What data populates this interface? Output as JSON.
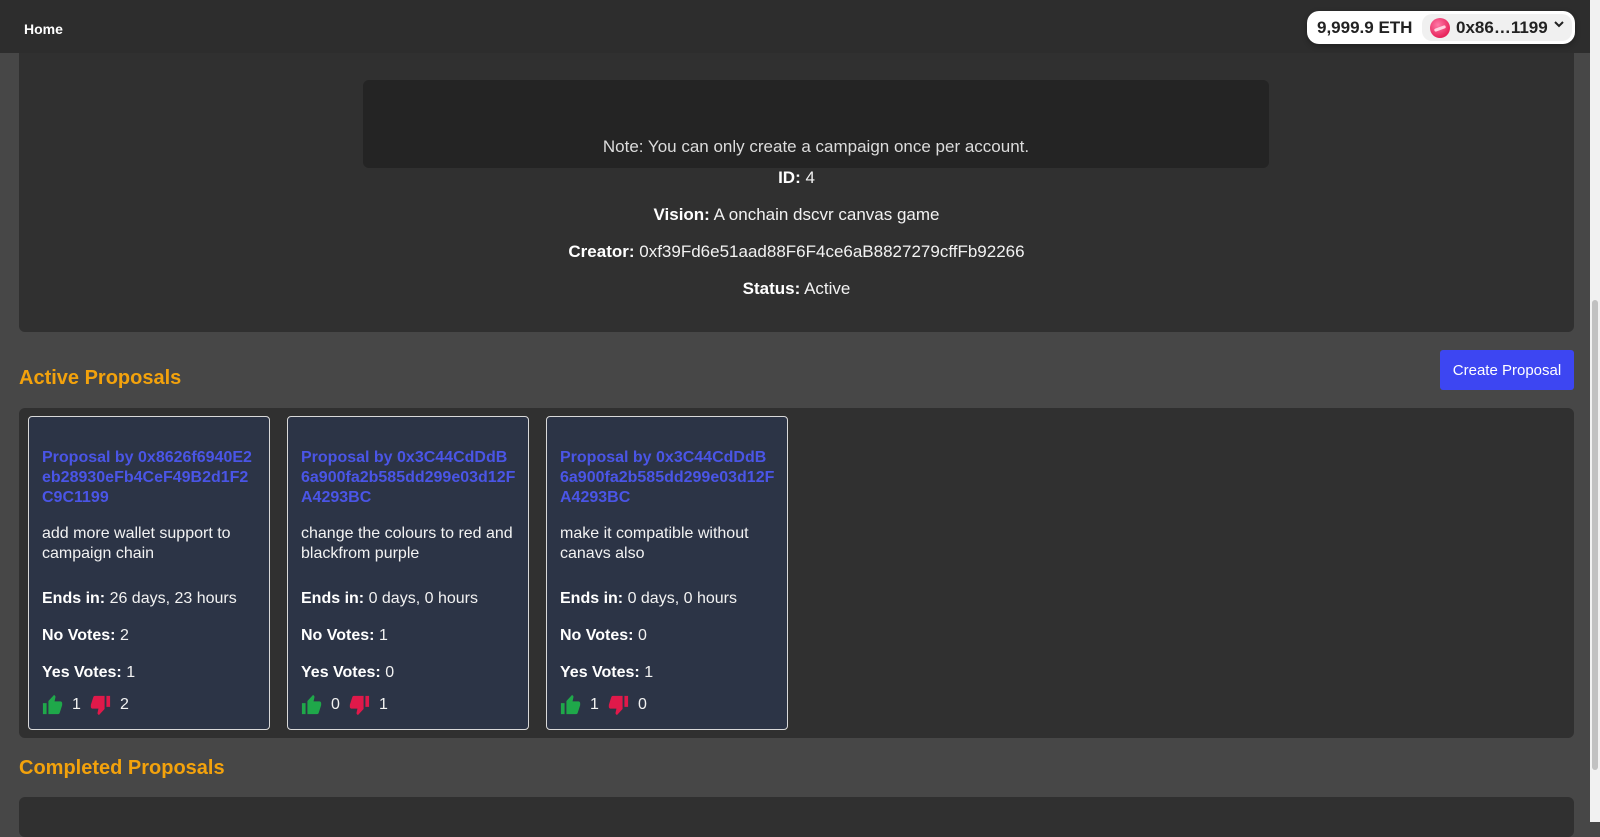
{
  "nav": {
    "home_label": "Home"
  },
  "wallet": {
    "balance": "9,999.9 ETH",
    "address": "0x86…1199",
    "avatar_icon": "account-avatar-icon",
    "chevron_icon": "chevron-down-icon"
  },
  "campaign": {
    "note": "Note: You can only create a campaign once per account.",
    "id_label": "ID:",
    "id_value": "4",
    "vision_label": "Vision:",
    "vision_value": "A onchain dscvr canvas game",
    "creator_label": "Creator:",
    "creator_value": "0xf39Fd6e51aad88F6F4ce6aB8827279cffFb92266",
    "status_label": "Status:",
    "status_value": "Active"
  },
  "active": {
    "title": "Active Proposals",
    "create_button": "Create Proposal",
    "cards": [
      {
        "title": "Proposal by 0x8626f6940E2eb28930eFb4CeF49B2d1F2C9C1199",
        "description": "add more wallet support to campaign chain",
        "ends_label": "Ends in:",
        "ends_value": "26 days, 23 hours",
        "no_label": "No Votes:",
        "no_value": "2",
        "yes_label": "Yes Votes:",
        "yes_value": "1",
        "up_count": "1",
        "down_count": "2"
      },
      {
        "title": "Proposal by 0x3C44CdDdB6a900fa2b585dd299e03d12FA4293BC",
        "description": "change the colours to red and blackfrom purple",
        "ends_label": "Ends in:",
        "ends_value": "0 days, 0 hours",
        "no_label": "No Votes:",
        "no_value": "1",
        "yes_label": "Yes Votes:",
        "yes_value": "0",
        "up_count": "0",
        "down_count": "1"
      },
      {
        "title": "Proposal by 0x3C44CdDdB6a900fa2b585dd299e03d12FA4293BC",
        "description": "make it compatible without canavs also",
        "ends_label": "Ends in:",
        "ends_value": "0 days, 0 hours",
        "no_label": "No Votes:",
        "no_value": "0",
        "yes_label": "Yes Votes:",
        "yes_value": "1",
        "up_count": "1",
        "down_count": "0"
      }
    ]
  },
  "completed": {
    "title": "Completed Proposals"
  },
  "colors": {
    "accent_orange": "#f3a20c",
    "primary_button": "#3d46f2",
    "proposal_link": "#4a55e6",
    "thumb_up": "#1fa84a",
    "thumb_down": "#e0194a"
  },
  "icons": {
    "up": "thumbs-up-icon",
    "down": "thumbs-down-icon"
  }
}
